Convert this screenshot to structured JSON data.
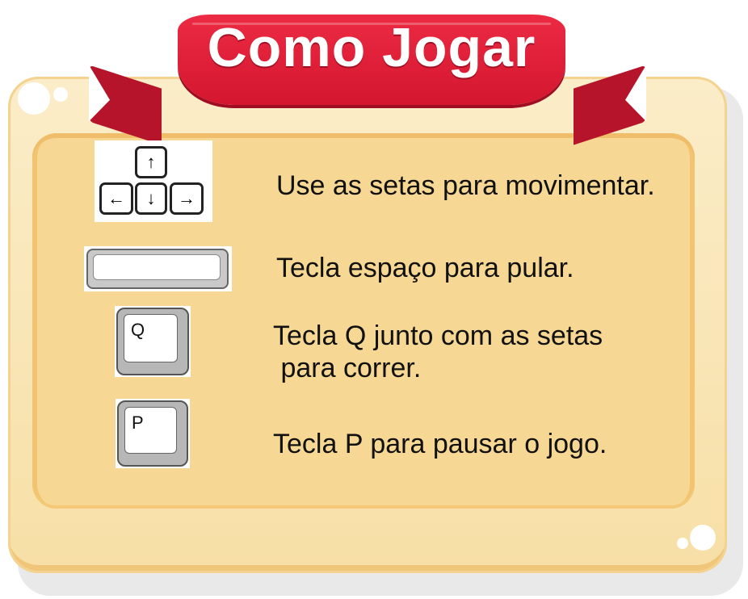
{
  "header": {
    "title": "Como Jogar"
  },
  "keys": {
    "up": "↑",
    "left": "←",
    "down": "↓",
    "right": "→",
    "q": "Q",
    "p": "P"
  },
  "instructions": [
    {
      "text": "Use as setas para movimentar."
    },
    {
      "text": "Tecla espaço para pular."
    },
    {
      "text": "Tecla Q junto com as setas\n para correr."
    },
    {
      "text": "Tecla P para pausar o jogo."
    }
  ],
  "colors": {
    "ribbon": "#d4162f",
    "board": "#f7dfa6",
    "panel": "#f6d793"
  }
}
